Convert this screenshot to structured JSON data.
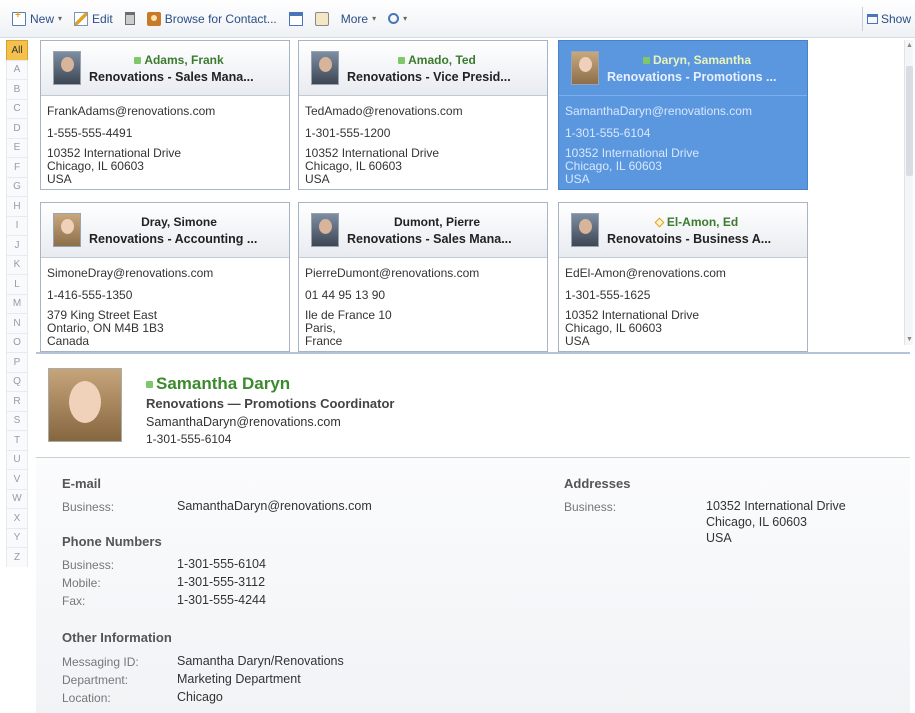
{
  "toolbar": {
    "new_label": "New",
    "edit_label": "Edit",
    "browse_label": "Browse for Contact...",
    "more_label": "More",
    "show_label": "Show"
  },
  "alphabet": [
    "All",
    "A",
    "B",
    "C",
    "D",
    "E",
    "F",
    "G",
    "H",
    "I",
    "J",
    "K",
    "L",
    "M",
    "N",
    "O",
    "P",
    "Q",
    "R",
    "S",
    "T",
    "U",
    "V",
    "W",
    "X",
    "Y",
    "Z"
  ],
  "cards": [
    {
      "name": "Adams, Frank",
      "company": "Renovations - Sales Mana...",
      "email": "FrankAdams@renovations.com",
      "phone": "1-555-555-4491",
      "street": "10352  International  Drive",
      "city": "Chicago,  IL  60603",
      "country": "USA",
      "status": "online"
    },
    {
      "name": "Amado, Ted",
      "company": "Renovations - Vice Presid...",
      "email": "TedAmado@renovations.com",
      "phone": "1-301-555-1200",
      "street": "10352  International  Drive",
      "city": "Chicago,  IL  60603",
      "country": "USA",
      "status": "online"
    },
    {
      "name": "Daryn, Samantha",
      "company": "Renovations - Promotions ...",
      "email": "SamanthaDaryn@renovations.com",
      "phone": "1-301-555-6104",
      "street": "10352  International  Drive",
      "city": "Chicago,  IL  60603",
      "country": "USA",
      "status": "online"
    },
    {
      "name": "Dray, Simone",
      "company": "Renovations - Accounting ...",
      "email": "SimoneDray@renovations.com",
      "phone": "1-416-555-1350",
      "street": "379 King Street East",
      "city": "Ontario, ON M4B 1B3",
      "country": "Canada",
      "status": "none"
    },
    {
      "name": "Dumont, Pierre",
      "company": "Renovations - Sales Mana...",
      "email": "PierreDumont@renovations.com",
      "phone": "01 44 95 13 90",
      "street": "Ile de France 10",
      "city": "Paris,",
      "country": "France",
      "status": "none"
    },
    {
      "name": "El-Amon, Ed",
      "company": "Renovatoins - Business A...",
      "email": "EdEl-Amon@renovations.com",
      "phone": "1-301-555-1625",
      "street": "10352  International  Drive",
      "city": "Chicago,  IL  60603",
      "country": "USA",
      "status": "away"
    }
  ],
  "detail": {
    "name": "Samantha Daryn",
    "title": "Renovations  —  Promotions Coordinator",
    "email": "SamanthaDaryn@renovations.com",
    "phone": "1-301-555-6104",
    "email_section": {
      "title": "E-mail",
      "label": "Business:",
      "value": "SamanthaDaryn@renovations.com"
    },
    "phone_section": {
      "title": "Phone Numbers",
      "rows": [
        {
          "label": "Business:",
          "value": "1-301-555-6104"
        },
        {
          "label": "Mobile:",
          "value": "1-301-555-3112"
        },
        {
          "label": "Fax:",
          "value": "1-301-555-4244"
        }
      ]
    },
    "address_section": {
      "title": "Addresses",
      "label": "Business:",
      "line1": "10352 International Drive",
      "line2": "Chicago, IL  60603",
      "line3": "USA"
    },
    "other_section": {
      "title": "Other Information",
      "rows": [
        {
          "label": "Messaging ID:",
          "value": "Samantha Daryn/Renovations"
        },
        {
          "label": "Department:",
          "value": "Marketing Department"
        },
        {
          "label": "Location:",
          "value": "Chicago"
        }
      ]
    }
  }
}
